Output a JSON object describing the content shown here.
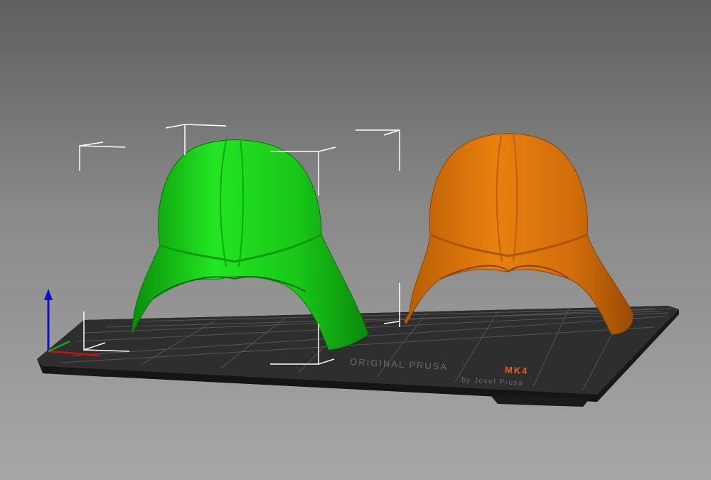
{
  "bed": {
    "brand_line1_prefix": "ORIGINAL PRUSA ",
    "brand_model": "MK4",
    "brand_line2": "by Josef Prusa"
  },
  "objects": [
    {
      "name": "helmet-left",
      "color": "#1fd11f",
      "selected": true
    },
    {
      "name": "helmet-right",
      "color": "#e27a10",
      "selected": false
    }
  ],
  "axes": {
    "x_color": "#d01010",
    "y_color": "#10b010",
    "z_color": "#1010c8"
  },
  "colors": {
    "background_top": "#5f5f5f",
    "background_bottom": "#a7a7a7",
    "bed": "#2b2b2b",
    "accent": "#e2621e"
  }
}
